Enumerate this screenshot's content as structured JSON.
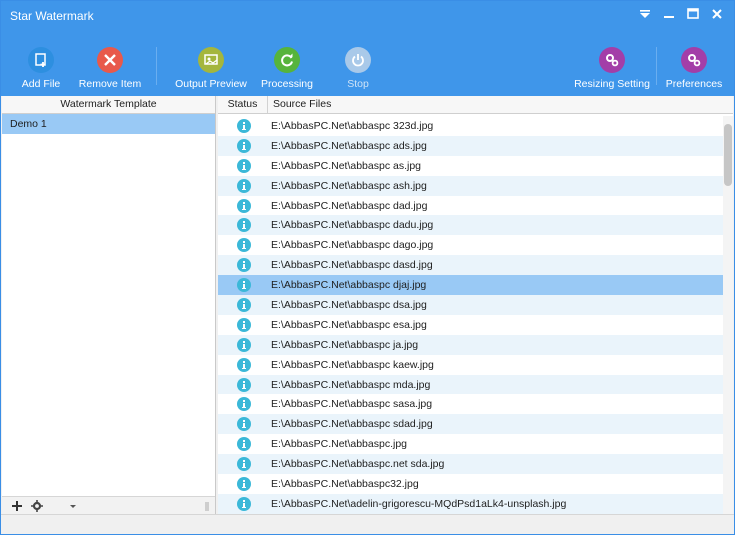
{
  "window": {
    "title": "Star Watermark"
  },
  "colors": {
    "accent": "#3f96ea",
    "selection": "#99c9f5",
    "status_icon": "#3bb8d8"
  },
  "toolbar": {
    "add_file": "Add File",
    "remove_item": "Remove Item",
    "output_preview": "Output Preview",
    "processing": "Processing",
    "stop": "Stop",
    "resizing_setting": "Resizing Setting",
    "preferences": "Preferences"
  },
  "left_panel": {
    "header": "Watermark Template",
    "items": [
      {
        "label": "Demo 1",
        "selected": true
      }
    ]
  },
  "file_list": {
    "headers": {
      "status": "Status",
      "source": "Source Files"
    },
    "rows": [
      {
        "path": "E:\\AbbasPC.Net\\abbaspc 323d.jpg",
        "status": "info-icon"
      },
      {
        "path": "E:\\AbbasPC.Net\\abbaspc ads.jpg",
        "status": "info-icon"
      },
      {
        "path": "E:\\AbbasPC.Net\\abbaspc as.jpg",
        "status": "info-icon"
      },
      {
        "path": "E:\\AbbasPC.Net\\abbaspc ash.jpg",
        "status": "info-icon"
      },
      {
        "path": "E:\\AbbasPC.Net\\abbaspc dad.jpg",
        "status": "info-icon"
      },
      {
        "path": "E:\\AbbasPC.Net\\abbaspc dadu.jpg",
        "status": "info-icon"
      },
      {
        "path": "E:\\AbbasPC.Net\\abbaspc dago.jpg",
        "status": "info-icon"
      },
      {
        "path": "E:\\AbbasPC.Net\\abbaspc dasd.jpg",
        "status": "info-icon"
      },
      {
        "path": "E:\\AbbasPC.Net\\abbaspc djaj.jpg",
        "status": "info-icon"
      },
      {
        "path": "E:\\AbbasPC.Net\\abbaspc dsa.jpg",
        "status": "info-icon"
      },
      {
        "path": "E:\\AbbasPC.Net\\abbaspc esa.jpg",
        "status": "info-icon"
      },
      {
        "path": "E:\\AbbasPC.Net\\abbaspc ja.jpg",
        "status": "info-icon"
      },
      {
        "path": "E:\\AbbasPC.Net\\abbaspc kaew.jpg",
        "status": "info-icon"
      },
      {
        "path": "E:\\AbbasPC.Net\\abbaspc mda.jpg",
        "status": "info-icon"
      },
      {
        "path": "E:\\AbbasPC.Net\\abbaspc sasa.jpg",
        "status": "info-icon"
      },
      {
        "path": "E:\\AbbasPC.Net\\abbaspc sdad.jpg",
        "status": "info-icon"
      },
      {
        "path": "E:\\AbbasPC.Net\\abbaspc.jpg",
        "status": "info-icon"
      },
      {
        "path": "E:\\AbbasPC.Net\\abbaspc.net sda.jpg",
        "status": "info-icon"
      },
      {
        "path": "E:\\AbbasPC.Net\\abbaspc32.jpg",
        "status": "info-icon"
      },
      {
        "path": "E:\\AbbasPC.Net\\adelin-grigorescu-MQdPsd1aLk4-unsplash.jpg",
        "status": "info-icon"
      }
    ],
    "selected_index": 8
  }
}
